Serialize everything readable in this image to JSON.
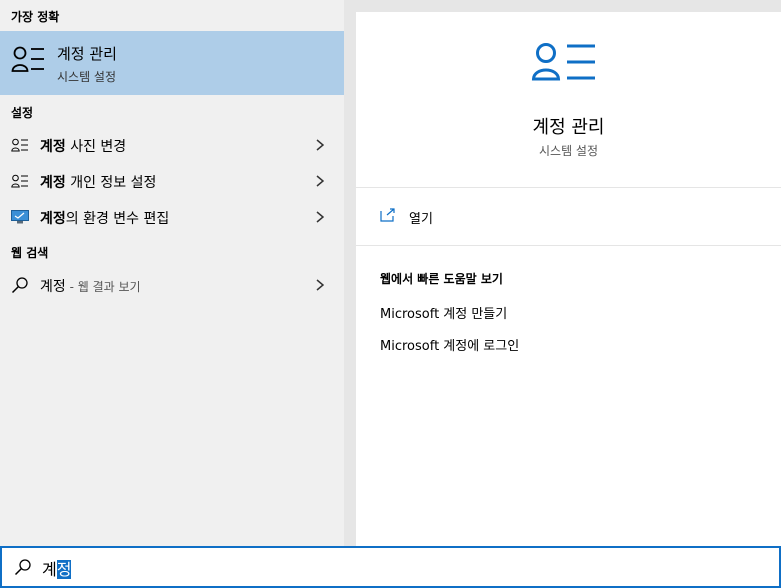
{
  "left": {
    "best_match_header": "가장 정확",
    "best_match": {
      "title": "계정 관리",
      "subtitle": "시스템 설정"
    },
    "settings_header": "설정",
    "settings_items": [
      {
        "bold": "계정",
        "rest": " 사진 변경",
        "icon": "user-list-icon"
      },
      {
        "bold": "계정",
        "rest": " 개인 정보 설정",
        "icon": "user-list-icon"
      },
      {
        "bold": "계정",
        "rest": "의 환경 변수 편집",
        "icon": "monitor-icon"
      }
    ],
    "web_header": "웹 검색",
    "web_item": {
      "term": "계정",
      "suffix": " - 웹 결과 보기"
    }
  },
  "right": {
    "title": "계정 관리",
    "subtitle": "시스템 설정",
    "open_label": "열기",
    "help_title": "웹에서 빠른 도움말 보기",
    "help_links": [
      "Microsoft 계정 만들기",
      "Microsoft 계정에 로그인"
    ]
  },
  "search": {
    "typed_plain": "계",
    "typed_selected": "정"
  },
  "colors": {
    "accent": "#0f6fc6",
    "highlight": "#aecde8"
  }
}
